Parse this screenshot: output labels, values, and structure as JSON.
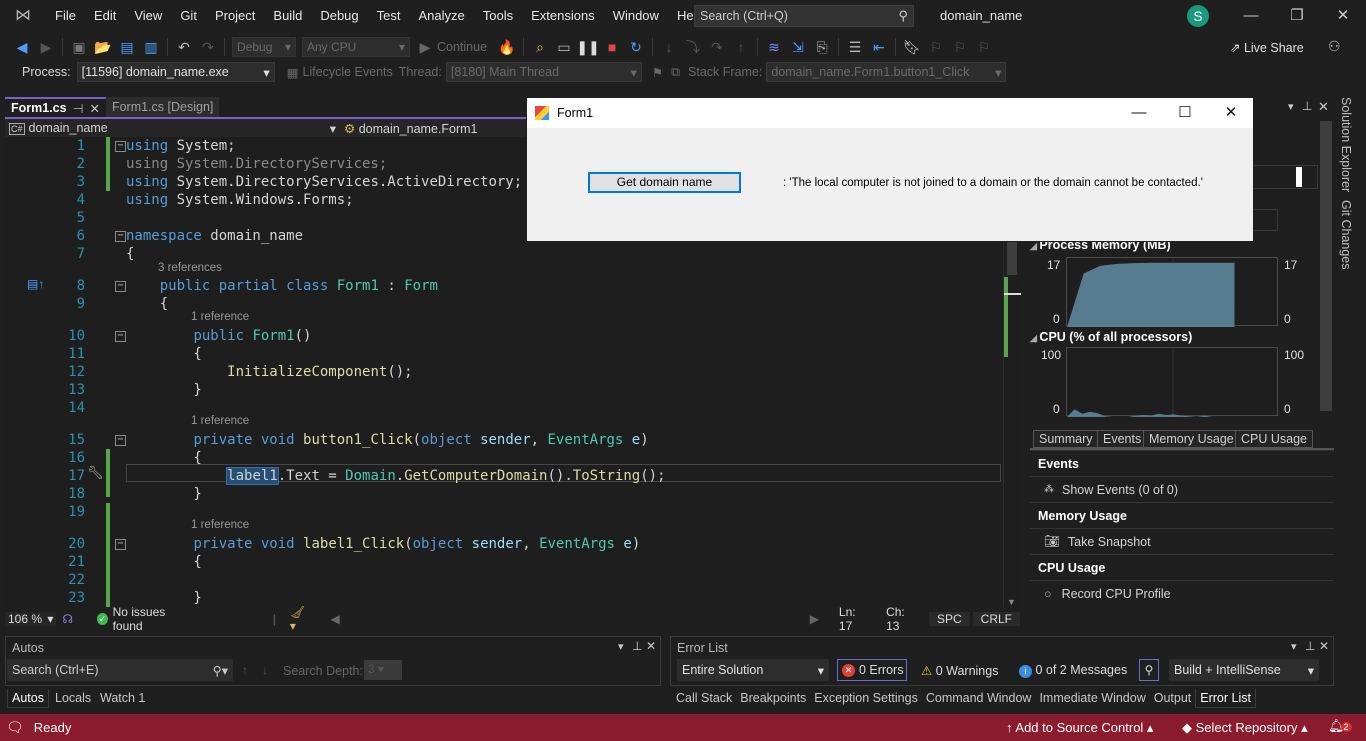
{
  "menubar": {
    "items": [
      "File",
      "Edit",
      "View",
      "Git",
      "Project",
      "Build",
      "Debug",
      "Test",
      "Analyze",
      "Tools",
      "Extensions",
      "Window",
      "Help"
    ],
    "search_placeholder": "Search (Ctrl+Q)",
    "solution_title": "domain_name",
    "avatar_initial": "S"
  },
  "toolbar": {
    "config": "Debug",
    "platform": "Any CPU",
    "continue_label": "Continue",
    "live_share": "Live Share"
  },
  "process_bar": {
    "process_label": "Process:",
    "process_value": "[11596] domain_name.exe",
    "lifecycle_label": "Lifecycle Events",
    "thread_label": "Thread:",
    "thread_value": "[8180] Main Thread",
    "stack_frame_label": "Stack Frame:",
    "stack_frame_value": "domain_name.Form1.button1_Click"
  },
  "doc_tabs": [
    {
      "label": "Form1.cs",
      "active": true
    },
    {
      "label": "Form1.cs [Design]",
      "active": false
    }
  ],
  "nav_bar": {
    "project": "domain_name",
    "type": "domain_name.Form1"
  },
  "code": {
    "lines": [
      {
        "n": "1",
        "html": "<span class=\"kw\">using</span> System;"
      },
      {
        "n": "2",
        "html": "<span class=\"dim\">using System.DirectoryServices;</span>"
      },
      {
        "n": "3",
        "html": "<span class=\"kw\">using</span> System.DirectoryServices.ActiveDirectory;"
      },
      {
        "n": "4",
        "html": "<span class=\"kw\">using</span> System.Windows.Forms;"
      },
      {
        "n": "5",
        "html": ""
      },
      {
        "n": "6",
        "html": "<span class=\"kw\">namespace</span> domain_name"
      },
      {
        "n": "7",
        "html": "{"
      },
      {
        "n": "8",
        "html": "    <span class=\"kw\">public partial class</span> <span class=\"ty\">Form1</span> : <span class=\"ty\">Form</span>"
      },
      {
        "n": "9",
        "html": "    {"
      },
      {
        "n": "10",
        "html": "        <span class=\"kw\">public</span> <span class=\"ty\">Form1</span>()"
      },
      {
        "n": "11",
        "html": "        {"
      },
      {
        "n": "12",
        "html": "            <span class=\"fn\">InitializeComponent</span>();"
      },
      {
        "n": "13",
        "html": "        }"
      },
      {
        "n": "14",
        "html": ""
      },
      {
        "n": "15",
        "html": "        <span class=\"kw\">private void</span> <span class=\"fn\">button1_Click</span>(<span class=\"kw\">object</span> <span class=\"pm\">sender</span>, <span class=\"ty\">EventArgs</span> <span class=\"pm\">e</span>)"
      },
      {
        "n": "16",
        "html": "        {"
      },
      {
        "n": "17",
        "html": "            <span id=\"sel-label\">label1</span>.Text = <span class=\"ty\">Domain</span>.<span class=\"fn\">GetComputerDomain</span>().<span class=\"fn\">ToString</span>();"
      },
      {
        "n": "18",
        "html": "        }"
      },
      {
        "n": "19",
        "html": ""
      },
      {
        "n": "20",
        "html": "        <span class=\"kw\">private void</span> <span class=\"fn\">label1_Click</span>(<span class=\"kw\">object</span> <span class=\"pm\">sender</span>, <span class=\"ty\">EventArgs</span> <span class=\"pm\">e</span>)"
      },
      {
        "n": "21",
        "html": "        {"
      },
      {
        "n": "22",
        "html": ""
      },
      {
        "n": "23",
        "html": "        }"
      }
    ],
    "lens": {
      "class_refs": "3 references",
      "ctor_refs": "1 reference",
      "button_refs": "1 reference",
      "label_refs": "1 reference"
    }
  },
  "editor_status": {
    "zoom": "106 %",
    "issues": "No issues found",
    "line": "Ln: 17",
    "col": "Ch: 13",
    "whitespace": "SPC",
    "line_ending": "CRLF"
  },
  "form1": {
    "title": "Form1",
    "button_label": "Get domain name",
    "label_text": ": 'The local computer is not joined to a domain or the domain cannot be contacted.'"
  },
  "diagnostics": {
    "process_memory_title": "Process Memory (MB)",
    "mem_max": "17",
    "mem_min": "0",
    "cpu_title": "CPU (% of all processors)",
    "cpu_max": "100",
    "cpu_min": "0",
    "tabs": [
      "Summary",
      "Events",
      "Memory Usage",
      "CPU Usage"
    ],
    "events_header": "Events",
    "show_events": "Show Events (0 of 0)",
    "memory_header": "Memory Usage",
    "take_snapshot": "Take Snapshot",
    "cpu_header": "CPU Usage",
    "record_cpu": "Record CPU Profile",
    "memory_series_mb": [
      0,
      14,
      16,
      16.5,
      16.7,
      16.8,
      16.8,
      16.8,
      16.8,
      16.8,
      16.8
    ],
    "cpu_series_pct": [
      0,
      12,
      5,
      8,
      6,
      1,
      0,
      0,
      0,
      2,
      3,
      2,
      5,
      3,
      4,
      2,
      1,
      0,
      2,
      0,
      0
    ]
  },
  "side_tabs": [
    "Solution Explorer",
    "Git Changes"
  ],
  "autos": {
    "title": "Autos",
    "search_placeholder": "Search (Ctrl+E)",
    "search_depth_label": "Search Depth:",
    "search_depth_value": "3",
    "tabs": [
      "Autos",
      "Locals",
      "Watch 1"
    ]
  },
  "error_list": {
    "title": "Error List",
    "scope": "Entire Solution",
    "errors": "0 Errors",
    "warnings": "0 Warnings",
    "messages": "0 of 2 Messages",
    "source": "Build + IntelliSense",
    "tabs": [
      "Call Stack",
      "Breakpoints",
      "Exception Settings",
      "Command Window",
      "Immediate Window",
      "Output",
      "Error List"
    ]
  },
  "statusbar": {
    "ready": "Ready",
    "add_source_control": "Add to Source Control",
    "select_repository": "Select Repository",
    "notification_count": "2"
  },
  "colors": {
    "accent": "#7a5fd1",
    "status_bar": "#8a1c2e",
    "memory_fill": "#5b8196",
    "cpu_fill": "#5b8196"
  }
}
